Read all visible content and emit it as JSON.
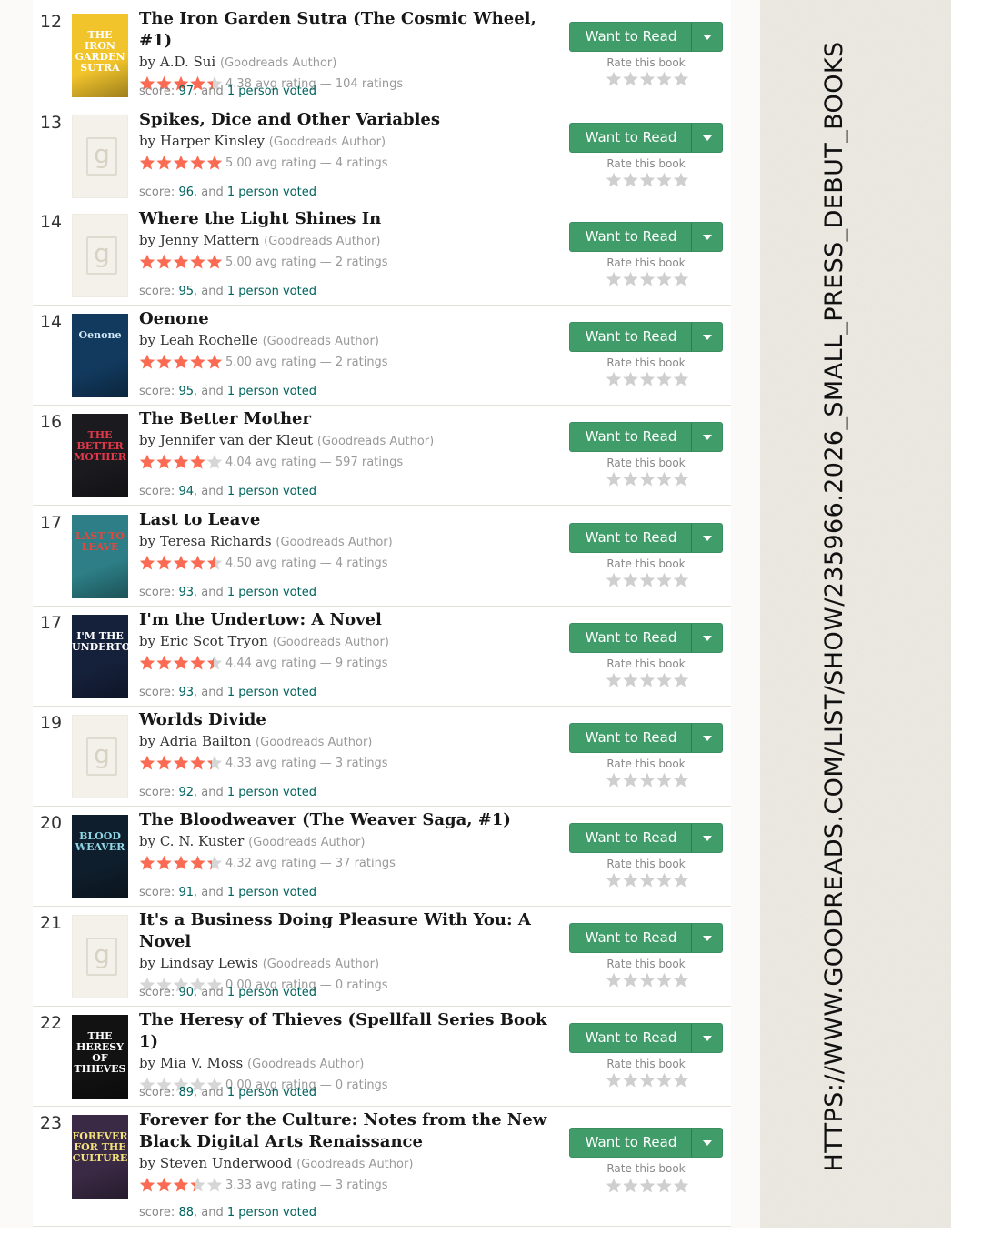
{
  "url_caption": "HTTPS://WWW.GOODREADS.COM/LIST/SHOW/235966.2026_SMALL_PRESS_DEBUT_BOOKS",
  "ui": {
    "want_to_read": "Want to Read",
    "rate_this_book": "Rate this book",
    "author_tag": "(Goodreads Author)",
    "star_color": "#fb6a52",
    "button_color": "#409d69",
    "link_color": "#00635d"
  },
  "books": [
    {
      "rank": "12",
      "title": "The Iron Garden Sutra (The Cosmic Wheel, #1)",
      "author": "A.D. Sui",
      "rating": 4.38,
      "rating_text": "4.38 avg rating — 104 ratings",
      "score": "97",
      "voters": "1 person voted",
      "cover": {
        "kind": "art",
        "bg": "#f2c42c",
        "fg": "#ffffff",
        "text": "THE IRON GARDEN SUTRA"
      }
    },
    {
      "rank": "13",
      "title": "Spikes, Dice and Other Variables",
      "author": "Harper Kinsley",
      "rating": 5.0,
      "rating_text": "5.00 avg rating — 4 ratings",
      "score": "96",
      "voters": "1 person voted",
      "cover": {
        "kind": "placeholder"
      }
    },
    {
      "rank": "14",
      "title": "Where the Light Shines In",
      "author": "Jenny Mattern",
      "rating": 5.0,
      "rating_text": "5.00 avg rating — 2 ratings",
      "score": "95",
      "voters": "1 person voted",
      "cover": {
        "kind": "placeholder"
      }
    },
    {
      "rank": "14",
      "title": "Oenone",
      "author": "Leah Rochelle",
      "rating": 5.0,
      "rating_text": "5.00 avg rating — 2 ratings",
      "score": "95",
      "voters": "1 person voted",
      "cover": {
        "kind": "art",
        "bg": "#123a5e",
        "fg": "#cfe6f5",
        "text": "Oenone"
      }
    },
    {
      "rank": "16",
      "title": "The Better Mother",
      "author": "Jennifer van der Kleut",
      "rating": 4.04,
      "rating_text": "4.04 avg rating — 597 ratings",
      "score": "94",
      "voters": "1 person voted",
      "cover": {
        "kind": "art",
        "bg": "#1b1b1f",
        "fg": "#e2394a",
        "text": "THE BETTER MOTHER"
      }
    },
    {
      "rank": "17",
      "title": "Last to Leave",
      "author": "Teresa Richards",
      "rating": 4.5,
      "rating_text": "4.50 avg rating — 4 ratings",
      "score": "93",
      "voters": "1 person voted",
      "cover": {
        "kind": "art",
        "bg": "#2d7e86",
        "fg": "#e4473c",
        "text": "LAST TO LEAVE"
      }
    },
    {
      "rank": "17",
      "title": "I'm the Undertow: A Novel",
      "author": "Eric Scot Tryon",
      "rating": 4.44,
      "rating_text": "4.44 avg rating — 9 ratings",
      "score": "93",
      "voters": "1 person voted",
      "cover": {
        "kind": "art",
        "bg": "#15203a",
        "fg": "#ffffff",
        "text": "I'M THE UNDERTOW"
      }
    },
    {
      "rank": "19",
      "title": "Worlds Divide",
      "author": "Adria Bailton",
      "rating": 4.33,
      "rating_text": "4.33 avg rating — 3 ratings",
      "score": "92",
      "voters": "1 person voted",
      "cover": {
        "kind": "placeholder"
      }
    },
    {
      "rank": "20",
      "title": "The Bloodweaver (The Weaver Saga, #1)",
      "author": "C. N. Kuster",
      "rating": 4.32,
      "rating_text": "4.32 avg rating — 37 ratings",
      "score": "91",
      "voters": "1 person voted",
      "cover": {
        "kind": "art",
        "bg": "#0f1e2c",
        "fg": "#8fd7e6",
        "text": "BLOOD WEAVER"
      }
    },
    {
      "rank": "21",
      "title": "It's a Business Doing Pleasure With You: A Novel",
      "author": "Lindsay Lewis",
      "rating": 0.0,
      "rating_text": "0.00 avg rating — 0 ratings",
      "score": "90",
      "voters": "1 person voted",
      "cover": {
        "kind": "placeholder"
      }
    },
    {
      "rank": "22",
      "title": "The Heresy of Thieves (Spellfall Series Book 1)",
      "author": "Mia V. Moss",
      "rating": 0.0,
      "rating_text": "0.00 avg rating — 0 ratings",
      "score": "89",
      "voters": "1 person voted",
      "cover": {
        "kind": "art",
        "bg": "#121212",
        "fg": "#ffffff",
        "text": "THE HERESY OF THIEVES"
      }
    },
    {
      "rank": "23",
      "title": "Forever for the Culture: Notes from the New Black Digital Arts Renaissance",
      "author": "Steven Underwood",
      "rating": 3.33,
      "rating_text": "3.33 avg rating — 3 ratings",
      "score": "88",
      "voters": "1 person voted",
      "cover": {
        "kind": "art",
        "bg": "#3b2a45",
        "fg": "#f4e37a",
        "text": "FOREVER FOR THE CULTURE"
      }
    }
  ]
}
